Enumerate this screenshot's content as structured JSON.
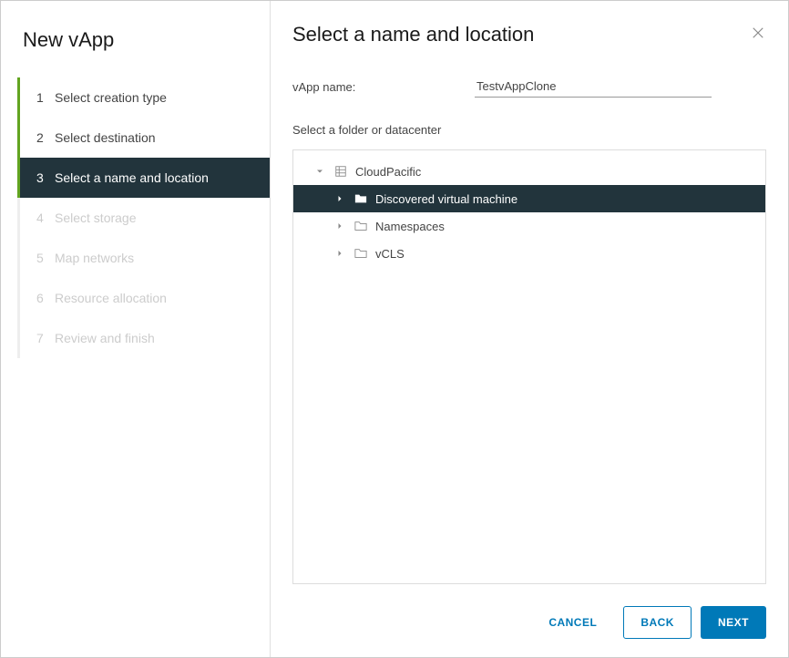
{
  "sidebar": {
    "title": "New vApp",
    "steps": [
      {
        "num": "1",
        "label": "Select creation type",
        "state": "completed"
      },
      {
        "num": "2",
        "label": "Select destination",
        "state": "completed"
      },
      {
        "num": "3",
        "label": "Select a name and location",
        "state": "current"
      },
      {
        "num": "4",
        "label": "Select storage",
        "state": "disabled"
      },
      {
        "num": "5",
        "label": "Map networks",
        "state": "disabled"
      },
      {
        "num": "6",
        "label": "Resource allocation",
        "state": "disabled"
      },
      {
        "num": "7",
        "label": "Review and finish",
        "state": "disabled"
      }
    ]
  },
  "main": {
    "title": "Select a name and location",
    "field_label": "vApp name:",
    "field_value": "TestvAppClone",
    "subhead": "Select a folder or datacenter",
    "tree": [
      {
        "depth": 0,
        "label": "CloudPacific",
        "icon": "datacenter",
        "expanded": true,
        "selected": false
      },
      {
        "depth": 1,
        "label": "Discovered virtual machine",
        "icon": "folder",
        "expanded": false,
        "selected": true
      },
      {
        "depth": 1,
        "label": "Namespaces",
        "icon": "folder",
        "expanded": false,
        "selected": false
      },
      {
        "depth": 1,
        "label": "vCLS",
        "icon": "folder",
        "expanded": false,
        "selected": false
      }
    ]
  },
  "footer": {
    "cancel": "CANCEL",
    "back": "BACK",
    "next": "NEXT"
  }
}
